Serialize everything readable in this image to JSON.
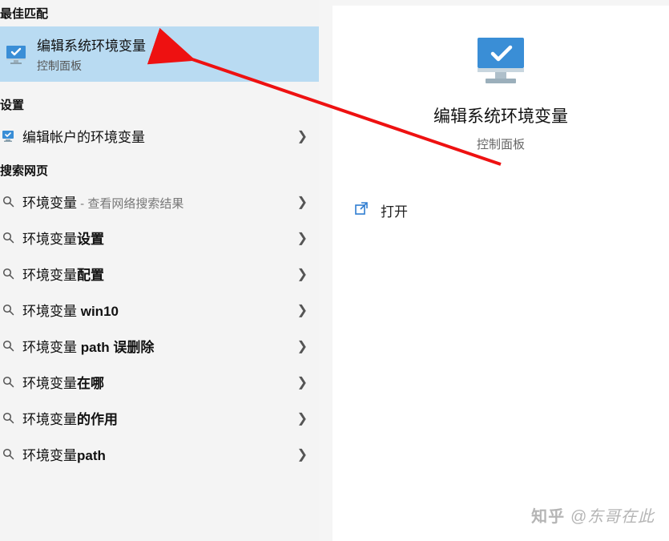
{
  "left": {
    "section_best_match": "最佳匹配",
    "best_match": {
      "title": "编辑系统环境变量",
      "subtitle": "控制面板"
    },
    "section_settings": "设置",
    "settings_items": [
      {
        "label": "编辑帐户的环境变量"
      }
    ],
    "section_websearch": "搜索网页",
    "search_items": [
      {
        "prefix": "环境变量",
        "suffix_faint": " - 查看网络搜索结果",
        "bold_tail": ""
      },
      {
        "prefix": "环境变量",
        "bold_tail": "设置"
      },
      {
        "prefix": "环境变量",
        "bold_tail": "配置"
      },
      {
        "prefix": "环境变量 ",
        "bold_tail": "win10"
      },
      {
        "prefix": "环境变量 ",
        "bold_tail": "path 误删除"
      },
      {
        "prefix": "环境变量",
        "bold_tail": "在哪"
      },
      {
        "prefix": "环境变量",
        "bold_tail": "的作用"
      },
      {
        "prefix": "环境变量",
        "bold_tail": "path"
      }
    ]
  },
  "right": {
    "title": "编辑系统环境变量",
    "subtitle": "控制面板",
    "open_label": "打开"
  },
  "watermark": {
    "brand": "知乎",
    "at": "@东哥在此"
  },
  "colors": {
    "highlight": "#b9dbf2",
    "accent": "#2f7dd1",
    "arrow": "#e11"
  }
}
